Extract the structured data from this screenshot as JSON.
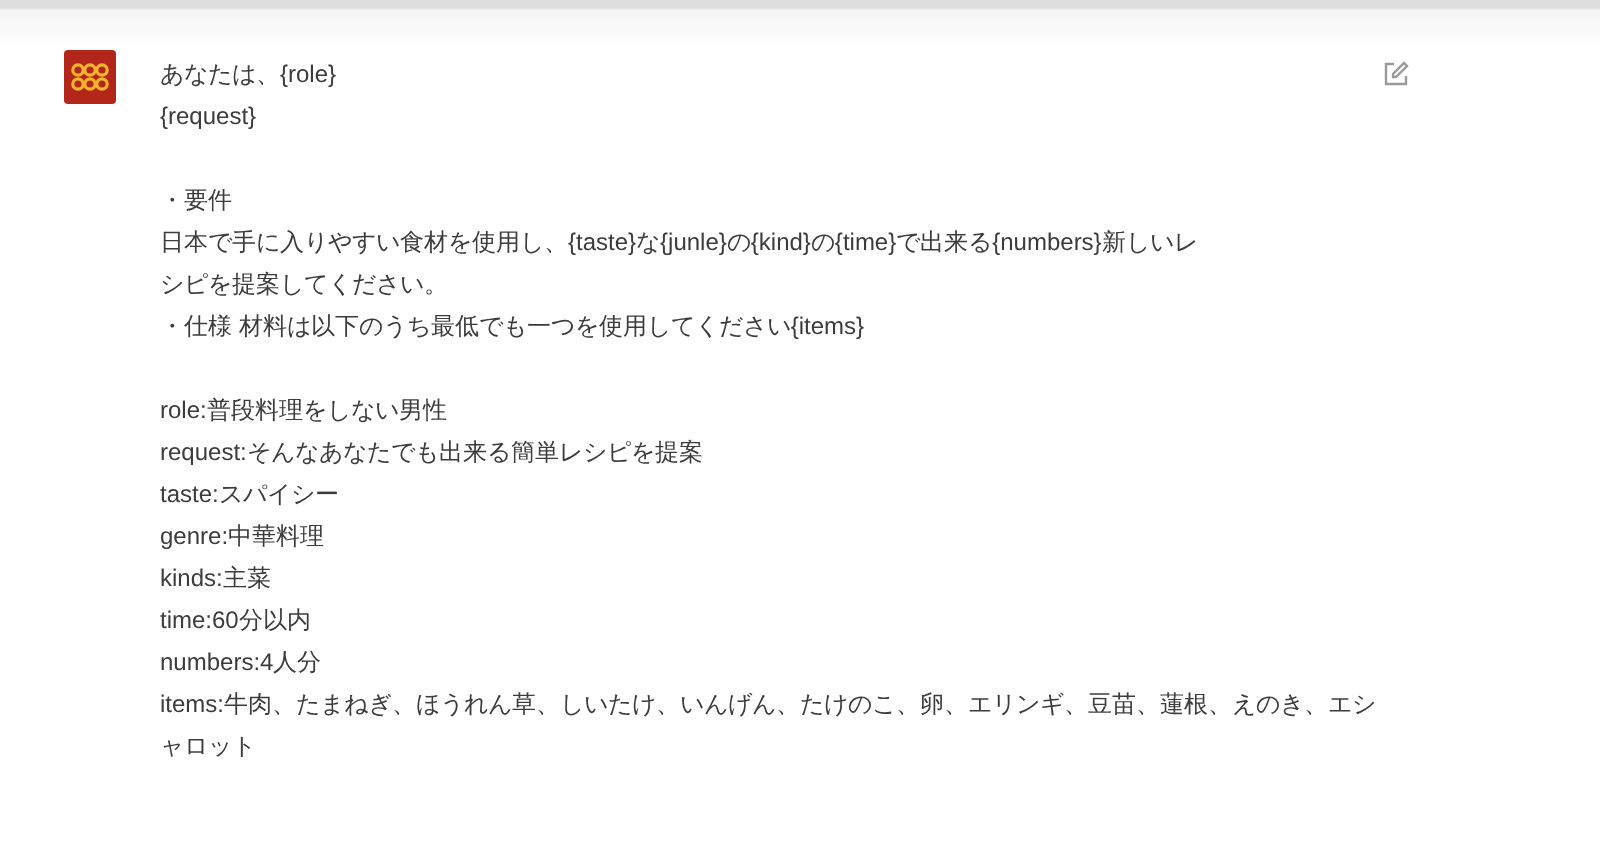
{
  "message": {
    "paragraphs": [
      [
        "あなたは、{role}",
        "{request}"
      ],
      [
        "・要件",
        "日本で手に入りやすい食材を使用し、{taste}な{junle}の{kind}の{time}で出来る{numbers}新しいレ",
        "シピを提案してください。",
        "・仕様 材料は以下のうち最低でも一つを使用してください{items}"
      ],
      [
        "role:普段料理をしない男性",
        "request:そんなあなたでも出来る簡単レシピを提案",
        "taste:スパイシー",
        "genre:中華料理",
        "kinds:主菜",
        "time:60分以内",
        "numbers:4人分",
        "items:牛肉、たまねぎ、ほうれん草、しいたけ、いんげん、たけのこ、卵、エリンギ、豆苗、蓮根、えのき、エシ",
        "ャロット"
      ]
    ]
  }
}
